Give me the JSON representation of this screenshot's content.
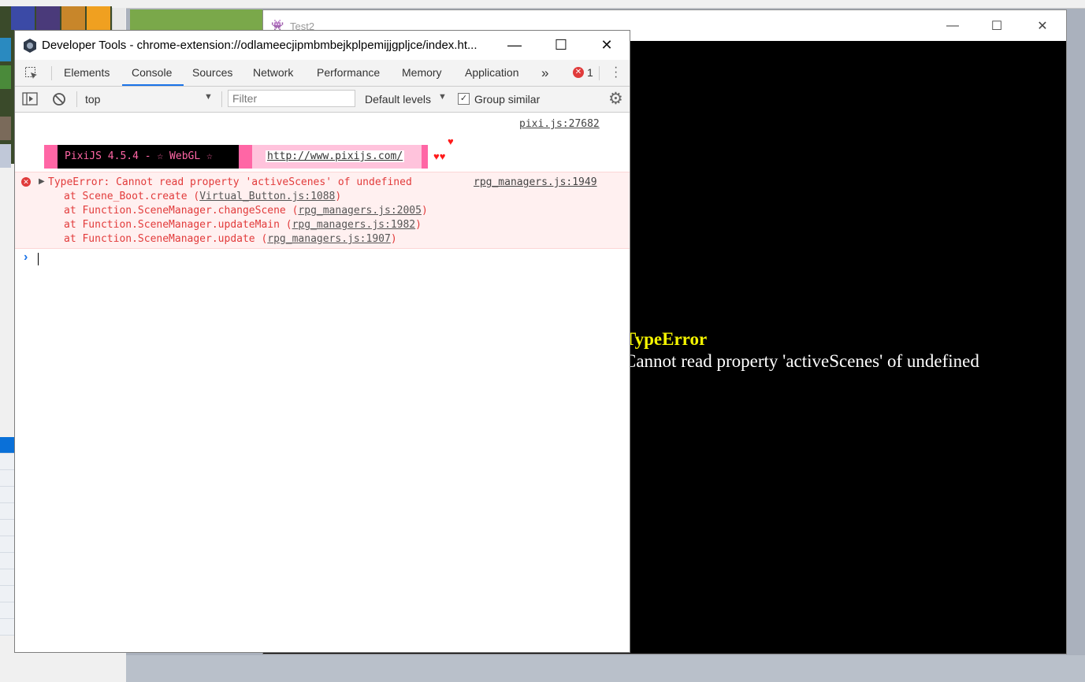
{
  "game_window": {
    "title": "Test2",
    "error_title": "TypeError",
    "error_message": "Cannot read property 'activeScenes' of undefined"
  },
  "devtools": {
    "title": "Developer Tools - chrome-extension://odlameecjipmbmbejkplpemijjgpljce/index.ht...",
    "tabs": [
      "Elements",
      "Console",
      "Sources",
      "Network",
      "Performance",
      "Memory",
      "Application"
    ],
    "active_tab": "Console",
    "more_tabs": "»",
    "error_count": "1",
    "toolbar": {
      "context": "top",
      "filter_placeholder": "Filter",
      "levels": "Default levels",
      "group_similar": "Group similar",
      "group_similar_checked": true
    },
    "console": {
      "pixi_source": "pixi.js:27682",
      "pixi_banner_text": "PixiJS 4.5.4 - ☆ WebGL ☆",
      "pixi_url": "http://www.pixijs.com/",
      "hearts": "♥♥",
      "heart_top": "♥",
      "error_source": "rpg_managers.js:1949",
      "error_message": "TypeError: Cannot read property 'activeScenes' of undefined",
      "stack": [
        {
          "text": "at Scene_Boot.create (",
          "link": "Virtual_Button.js:1088",
          "end": ")"
        },
        {
          "text": "at Function.SceneManager.changeScene (",
          "link": "rpg_managers.js:2005",
          "end": ")"
        },
        {
          "text": "at Function.SceneManager.updateMain (",
          "link": "rpg_managers.js:1982",
          "end": ")"
        },
        {
          "text": "at Function.SceneManager.update (",
          "link": "rpg_managers.js:1907",
          "end": ")"
        }
      ],
      "prompt": "›"
    }
  }
}
